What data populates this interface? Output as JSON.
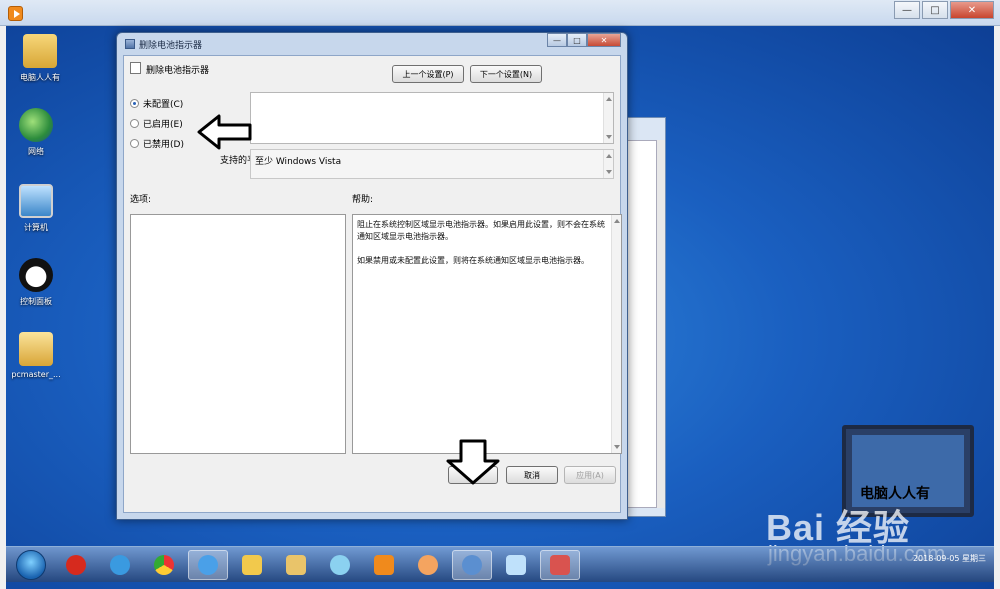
{
  "desktop_icons": [
    {
      "label": "电脑人人有",
      "icon": "folder-icon"
    },
    {
      "label": "网络",
      "icon": "network-icon"
    },
    {
      "label": "计算机",
      "icon": "computer-icon"
    },
    {
      "label": "控制面板",
      "icon": "control-panel-icon"
    },
    {
      "label": "pcmaster_...",
      "icon": "installer-icon"
    }
  ],
  "dialog": {
    "title": "删除电池指示器",
    "policy_name": "删除电池指示器",
    "prev_button": "上一个设置(P)",
    "next_button": "下一个设置(N)",
    "radio_options": [
      {
        "label": "未配置(C)",
        "selected": true
      },
      {
        "label": "已启用(E)",
        "selected": false
      },
      {
        "label": "已禁用(D)",
        "selected": false
      }
    ],
    "supported_label": "支持的平台:",
    "supported_value": "至少 Windows Vista",
    "options_label": "选项:",
    "help_label": "帮助:",
    "help_text": "阻止在系统控制区域显示电池指示器。如果启用此设置，则不会在系统通知区域显示电池指示器。\n\n如果禁用或未配置此设置，则将在系统通知区域显示电池指示器。",
    "ok_button": "确定",
    "cancel_button": "取消",
    "apply_button": "应用(A)"
  },
  "taskbar": {
    "items": [
      "start-icon",
      "app-red-icon",
      "ie-icon",
      "chrome-icon",
      "browser-icon",
      "folder-icon",
      "explorer-icon",
      "pinwheel-icon",
      "media-icon",
      "paint-icon",
      "settings-icon",
      "cube-icon",
      "toolbox-icon"
    ],
    "date": "2018-09-05 星期三"
  },
  "watermark": {
    "caption": "电脑人人有",
    "brand": "Bai 经验",
    "url": "jingyan.baidu.com"
  },
  "colors": {
    "accent": "#2b63b8",
    "desktop": "#1a5fc0"
  }
}
